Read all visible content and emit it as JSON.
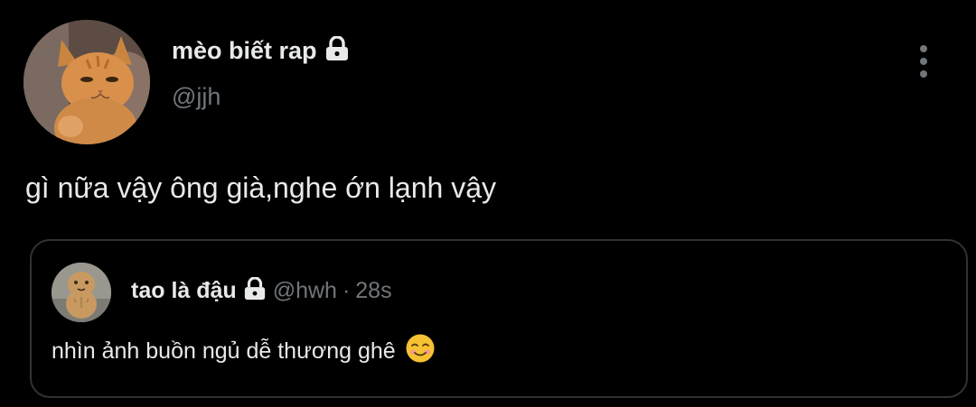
{
  "author": {
    "display_name": "mèo biết rap",
    "handle": "@jjh",
    "avatar_icon": "cat-avatar",
    "protected_icon": "lock-icon"
  },
  "tweet": {
    "text": "gì nữa vậy ông già,nghe ớn lạnh vậy"
  },
  "menu": {
    "icon": "more-vertical-icon"
  },
  "quote": {
    "display_name": "tao là đậu",
    "handle": "@hwh",
    "separator": "·",
    "time": "28s",
    "text": "nhìn ảnh buồn ngủ dễ thương ghê",
    "emoji_icon": "smiling-face-icon",
    "avatar_icon": "peanut-avatar",
    "protected_icon": "lock-icon"
  },
  "colors": {
    "background": "#000000",
    "text_primary": "#e7e9ea",
    "text_secondary": "#71767b",
    "border": "#2f3336"
  }
}
